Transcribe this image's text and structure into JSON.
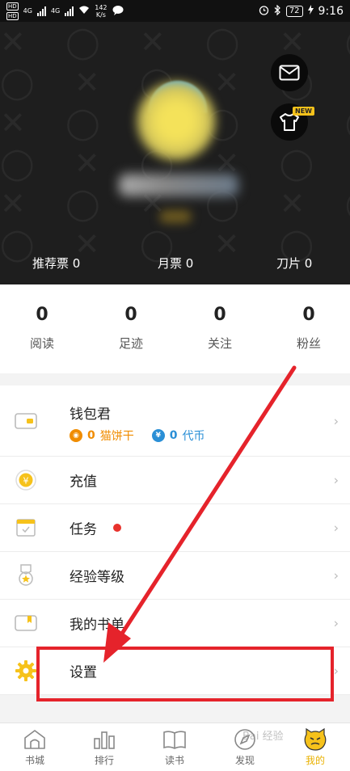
{
  "status_bar": {
    "sim_badges": [
      "HD",
      "HD"
    ],
    "signal_labels": [
      "4G",
      "4G"
    ],
    "net_speed": "142",
    "net_unit": "K/s",
    "battery": "72",
    "time": "9:16"
  },
  "header": {
    "new_tag": "NEW",
    "tickets": [
      {
        "label": "推荐票 0"
      },
      {
        "label": "月票 0"
      },
      {
        "label": "刀片 0"
      }
    ]
  },
  "stats": [
    {
      "value": "0",
      "label": "阅读"
    },
    {
      "value": "0",
      "label": "足迹"
    },
    {
      "value": "0",
      "label": "关注"
    },
    {
      "value": "0",
      "label": "粉丝"
    }
  ],
  "menu": {
    "wallet": {
      "label": "钱包君",
      "cookie_value": "0",
      "cookie_label": "猫饼干",
      "coin_value": "0",
      "coin_label": "代币"
    },
    "recharge": "充值",
    "tasks": "任务",
    "level": "经验等级",
    "my_list": "我的书单",
    "settings": "设置"
  },
  "colors": {
    "accent": "#f6c21b",
    "annotation": "#e5232b",
    "cookie": "#f08c00",
    "coin": "#2a8fd6"
  },
  "nav": [
    {
      "label": "书城",
      "icon": "house-icon"
    },
    {
      "label": "排行",
      "icon": "bar-chart-icon"
    },
    {
      "label": "读书",
      "icon": "book-icon"
    },
    {
      "label": "发现",
      "icon": "compass-icon"
    },
    {
      "label": "我的",
      "icon": "cat-face-icon",
      "active": true
    }
  ],
  "watermark": "Bai 经验"
}
